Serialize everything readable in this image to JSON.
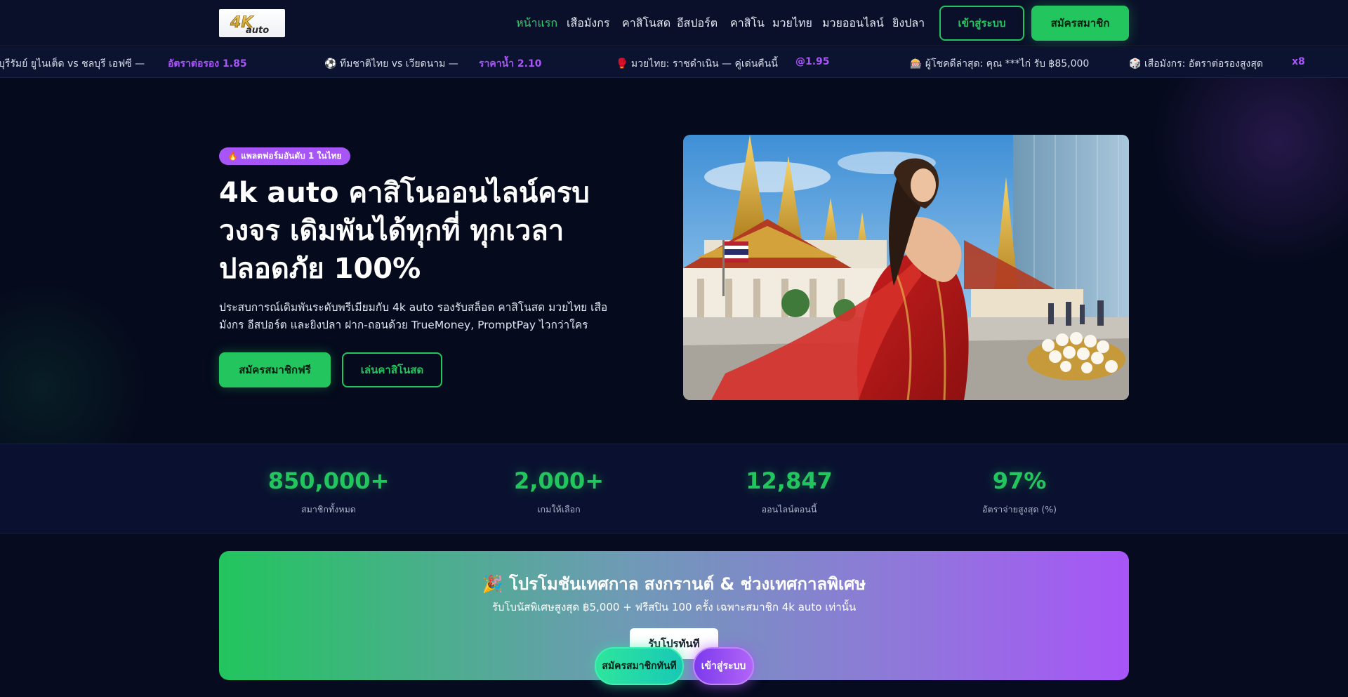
{
  "header": {
    "logo_text": "4K auto",
    "nav": [
      {
        "label": "หน้าแรก",
        "active": true
      },
      {
        "label": "เสือมังกร"
      },
      {
        "label": "คาสิโนสด"
      },
      {
        "label": "อีสปอร์ต"
      },
      {
        "label": "คาสิโน"
      },
      {
        "label": "มวยไทย"
      },
      {
        "label": "มวยออนไลน์"
      },
      {
        "label": "ยิงปลา"
      }
    ],
    "login_label": "เข้าสู่ระบบ",
    "register_label": "สมัครสมาชิก"
  },
  "ticker": [
    {
      "text": "บุรีรัมย์ ยูไนเต็ด vs ชลบุรี เอฟซี —",
      "odds": "อัตราต่อรอง 1.85"
    },
    {
      "text": "⚽ ทีมชาติไทย vs เวียดนาม —",
      "odds": "ราคาน้ำ 2.10"
    },
    {
      "text": "🥊 มวยไทย: ราชดำเนิน — คู่เด่นคืนนี้",
      "odds": "@1.95"
    },
    {
      "text": "🎰 ผู้โชคดีล่าสุด: คุณ ***ไก่ รับ ฿85,000",
      "odds": ""
    },
    {
      "text": "🎲 เสือมังกร: อัตราต่อรองสูงสุด",
      "odds": "x8"
    }
  ],
  "hero": {
    "badge": "🔥 แพลตฟอร์มอันดับ 1 ในไทย",
    "title": "4k auto คาสิโนออนไลน์ครบวงจร เดิมพันได้ทุกที่ ทุกเวลา ปลอดภัย 100%",
    "description": "ประสบการณ์เดิมพันระดับพรีเมียมกับ 4k auto รองรับสล็อต คาสิโนสด มวยไทย เสือมังกร อีสปอร์ต และยิงปลา ฝาก-ถอนด้วย TrueMoney, PromptPay ไวกว่าใคร",
    "primary_button": "สมัครสมาชิกฟรี",
    "secondary_button": "เล่นคาสิโนสด"
  },
  "stats": [
    {
      "value": "850,000+",
      "label": "สมาชิกทั้งหมด"
    },
    {
      "value": "2,000+",
      "label": "เกมให้เลือก"
    },
    {
      "value": "12,847",
      "label": "ออนไลน์ตอนนี้"
    },
    {
      "value": "97%",
      "label": "อัตราจ่ายสูงสุด (%)"
    }
  ],
  "promo": {
    "title": "🎉 โปรโมชันเทศกาล สงกรานต์ & ช่วงเทศกาลพิเศษ",
    "subtitle": "รับโบนัสพิเศษสูงสุด ฿5,000 + ฟรีสปิน 100 ครั้ง เฉพาะสมาชิก 4k auto เท่านั้น",
    "button": "รับโปรทันที"
  },
  "floating": {
    "register_label": "สมัครสมาชิกทันที",
    "login_label": "เข้าสู่ระบบ"
  },
  "colors": {
    "accent_green": "#22c55e",
    "accent_purple": "#a855f7",
    "background": "#060b1f"
  }
}
